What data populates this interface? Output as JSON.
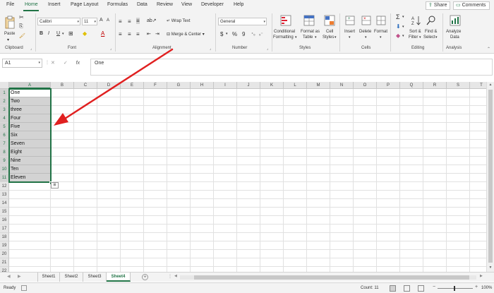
{
  "menu": {
    "tabs": [
      "File",
      "Home",
      "Insert",
      "Page Layout",
      "Formulas",
      "Data",
      "Review",
      "View",
      "Developer",
      "Help"
    ],
    "share_label": "Share",
    "comments_label": "Comments"
  },
  "ribbon": {
    "clipboard": {
      "paste_label": "Paste",
      "group_label": "Clipboard"
    },
    "font": {
      "font_name": "Calibri",
      "font_size": "11",
      "bold": "B",
      "italic": "I",
      "underline": "U",
      "grow": "A",
      "shrink": "A",
      "group_label": "Font"
    },
    "alignment": {
      "wrap_text_label": "Wrap Text",
      "merge_center_label": "Merge & Center",
      "group_label": "Alignment"
    },
    "number": {
      "format_value": "General",
      "currency": "$",
      "percent": "%",
      "comma": "9",
      "group_label": "Number"
    },
    "styles": {
      "conditional_line1": "Conditional",
      "conditional_line2": "Formatting",
      "format_table_line1": "Format as",
      "format_table_line2": "Table",
      "cell_styles_line1": "Cell",
      "cell_styles_line2": "Styles",
      "group_label": "Styles"
    },
    "cells": {
      "insert_label": "Insert",
      "delete_label": "Delete",
      "format_label": "Format",
      "group_label": "Cells"
    },
    "editing": {
      "sort_line1": "Sort &",
      "sort_line2": "Filter",
      "find_line1": "Find &",
      "find_line2": "Select",
      "group_label": "Editing"
    },
    "analysis": {
      "analyze_line1": "Analyze",
      "analyze_line2": "Data",
      "group_label": "Analysis"
    }
  },
  "formula_bar": {
    "name_box": "A1",
    "fx_label": "fx",
    "value": "One"
  },
  "grid": {
    "columns": [
      "A",
      "B",
      "C",
      "D",
      "E",
      "F",
      "G",
      "H",
      "I",
      "J",
      "K",
      "L",
      "M",
      "N",
      "O",
      "P",
      "Q",
      "R",
      "S",
      "T"
    ],
    "rows": [
      "1",
      "2",
      "3",
      "4",
      "5",
      "6",
      "7",
      "8",
      "9",
      "10",
      "11",
      "12",
      "13",
      "14",
      "15",
      "16",
      "17",
      "18",
      "19",
      "20",
      "21",
      "22"
    ],
    "column_a_values": [
      "One",
      "Two",
      "three",
      "Four",
      "Five",
      "Six",
      "Seven",
      "Eight",
      "Nine",
      "Ten",
      "Eleven"
    ]
  },
  "sheets": {
    "tabs": [
      "Sheet1",
      "Sheet2",
      "Sheet3",
      "Sheet4"
    ],
    "active": "Sheet4"
  },
  "status": {
    "ready": "Ready",
    "count": "Count: 11",
    "zoom": "100%"
  },
  "colors": {
    "accent": "#217346",
    "annotation": "#e02020"
  }
}
